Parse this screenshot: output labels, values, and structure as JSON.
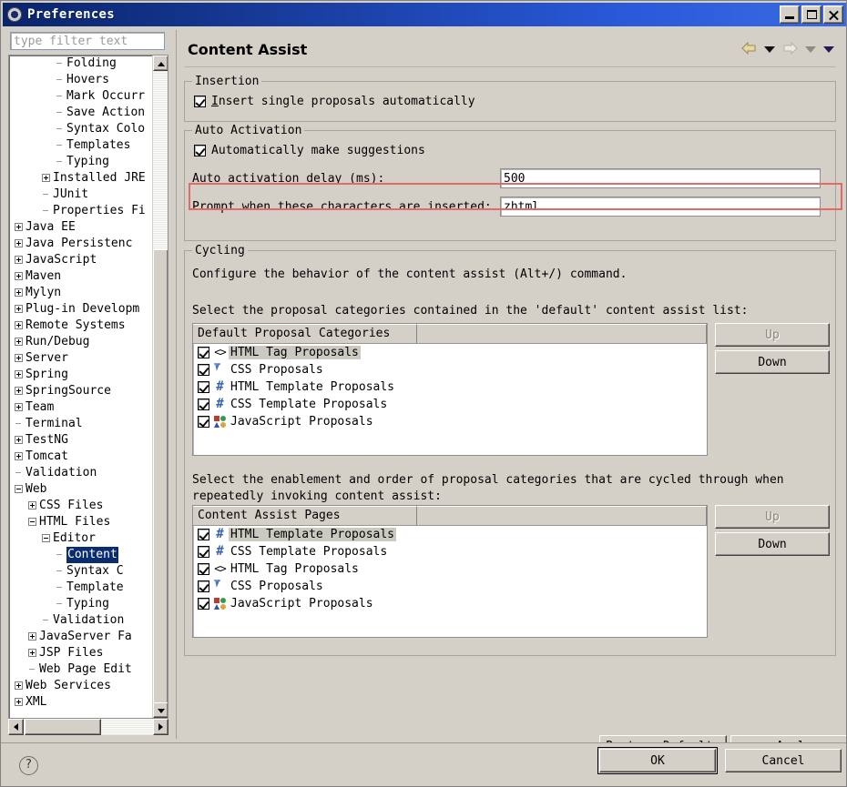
{
  "window": {
    "title": "Preferences",
    "icon": "preferences-icon",
    "controls": {
      "minimize": "Minimize",
      "maximize": "Maximize",
      "close": "Close"
    }
  },
  "sidebar": {
    "filter": {
      "placeholder": "type filter text",
      "value": ""
    },
    "tree": [
      {
        "label": "Folding",
        "indent": 4,
        "marker": "leaf"
      },
      {
        "label": "Hovers",
        "indent": 4,
        "marker": "leaf"
      },
      {
        "label": "Mark Occurr",
        "indent": 4,
        "marker": "leaf"
      },
      {
        "label": "Save Action",
        "indent": 4,
        "marker": "leaf"
      },
      {
        "label": "Syntax Colo",
        "indent": 4,
        "marker": "leaf"
      },
      {
        "label": "Templates",
        "indent": 4,
        "marker": "leaf"
      },
      {
        "label": "Typing",
        "indent": 4,
        "marker": "leaf"
      },
      {
        "label": "Installed JRE",
        "indent": 3,
        "marker": "plus"
      },
      {
        "label": "JUnit",
        "indent": 3,
        "marker": "leaf"
      },
      {
        "label": "Properties Fi",
        "indent": 3,
        "marker": "leaf"
      },
      {
        "label": "Java EE",
        "indent": 1,
        "marker": "plus"
      },
      {
        "label": "Java Persistenc",
        "indent": 1,
        "marker": "plus"
      },
      {
        "label": "JavaScript",
        "indent": 1,
        "marker": "plus"
      },
      {
        "label": "Maven",
        "indent": 1,
        "marker": "plus"
      },
      {
        "label": "Mylyn",
        "indent": 1,
        "marker": "plus"
      },
      {
        "label": "Plug-in Developm",
        "indent": 1,
        "marker": "plus"
      },
      {
        "label": "Remote Systems",
        "indent": 1,
        "marker": "plus"
      },
      {
        "label": "Run/Debug",
        "indent": 1,
        "marker": "plus"
      },
      {
        "label": "Server",
        "indent": 1,
        "marker": "plus"
      },
      {
        "label": "Spring",
        "indent": 1,
        "marker": "plus"
      },
      {
        "label": "SpringSource",
        "indent": 1,
        "marker": "plus"
      },
      {
        "label": "Team",
        "indent": 1,
        "marker": "plus"
      },
      {
        "label": "Terminal",
        "indent": 1,
        "marker": "leaf"
      },
      {
        "label": "TestNG",
        "indent": 1,
        "marker": "plus"
      },
      {
        "label": "Tomcat",
        "indent": 1,
        "marker": "plus"
      },
      {
        "label": "Validation",
        "indent": 1,
        "marker": "leaf"
      },
      {
        "label": "Web",
        "indent": 1,
        "marker": "minus"
      },
      {
        "label": "CSS Files",
        "indent": 2,
        "marker": "plus"
      },
      {
        "label": "HTML Files",
        "indent": 2,
        "marker": "minus"
      },
      {
        "label": "Editor",
        "indent": 3,
        "marker": "minus"
      },
      {
        "label": "Content",
        "indent": 4,
        "marker": "leaf",
        "selected": true
      },
      {
        "label": "Syntax C",
        "indent": 4,
        "marker": "leaf"
      },
      {
        "label": "Template",
        "indent": 4,
        "marker": "leaf"
      },
      {
        "label": "Typing",
        "indent": 4,
        "marker": "leaf"
      },
      {
        "label": "Validation",
        "indent": 3,
        "marker": "leaf"
      },
      {
        "label": "JavaServer Fa",
        "indent": 2,
        "marker": "plus"
      },
      {
        "label": "JSP Files",
        "indent": 2,
        "marker": "plus"
      },
      {
        "label": "Web Page Edit",
        "indent": 2,
        "marker": "leaf"
      },
      {
        "label": "Web Services",
        "indent": 1,
        "marker": "plus"
      },
      {
        "label": "XML",
        "indent": 1,
        "marker": "plus"
      }
    ]
  },
  "page": {
    "title": "Content Assist",
    "nav": {
      "back": "back-arrow",
      "back_menu": "back-dropdown",
      "forward": "forward-arrow",
      "forward_menu": "forward-dropdown",
      "menu": "view-menu"
    }
  },
  "insertion": {
    "group_label": "Insertion",
    "checkbox_label": "Insert single proposals automatically",
    "checked": true
  },
  "auto_activation": {
    "group_label": "Auto Activation",
    "checkbox_label": "Automatically make suggestions",
    "checked": true,
    "delay_label": "Auto activation delay (ms):",
    "delay_value": "500",
    "prompt_label": "Prompt when these characters are inserted:",
    "prompt_value": "zhtml",
    "highlight_color": "#e46a6a"
  },
  "cycling": {
    "group_label": "Cycling",
    "description": "Configure the behavior of the content assist (Alt+/) command.",
    "default_list_label": "Select the proposal categories contained in the 'default' content assist list:",
    "default_list": {
      "header": "Default Proposal Categories",
      "rows": [
        {
          "label": "HTML Tag Proposals",
          "icon": "tag-icon",
          "checked": true,
          "selected": true
        },
        {
          "label": "CSS Proposals",
          "icon": "css-cursor-icon",
          "checked": true,
          "selected": false
        },
        {
          "label": "HTML Template Proposals",
          "icon": "hash-icon",
          "checked": true,
          "selected": false
        },
        {
          "label": "CSS Template Proposals",
          "icon": "hash-icon",
          "checked": true,
          "selected": false
        },
        {
          "label": "JavaScript Proposals",
          "icon": "javascript-icon",
          "checked": true,
          "selected": false
        }
      ],
      "up_label": "Up",
      "down_label": "Down",
      "up_enabled": false,
      "down_enabled": true
    },
    "pages_list_label": "Select the enablement and order of proposal categories that are cycled through when repeatedly invoking content assist:",
    "pages_list": {
      "header": "Content Assist Pages",
      "rows": [
        {
          "label": "HTML Template Proposals",
          "icon": "hash-icon",
          "checked": true,
          "selected": true
        },
        {
          "label": "CSS Template Proposals",
          "icon": "hash-icon",
          "checked": true,
          "selected": false
        },
        {
          "label": "HTML Tag Proposals",
          "icon": "tag-icon",
          "checked": true,
          "selected": false
        },
        {
          "label": "CSS Proposals",
          "icon": "css-cursor-icon",
          "checked": true,
          "selected": false
        },
        {
          "label": "JavaScript Proposals",
          "icon": "javascript-icon",
          "checked": true,
          "selected": false
        }
      ],
      "up_label": "Up",
      "down_label": "Down",
      "up_enabled": false,
      "down_enabled": true
    }
  },
  "footer": {
    "restore_defaults": "Restore Defaults",
    "apply": "Apply",
    "ok": "OK",
    "cancel": "Cancel",
    "help": "?"
  }
}
